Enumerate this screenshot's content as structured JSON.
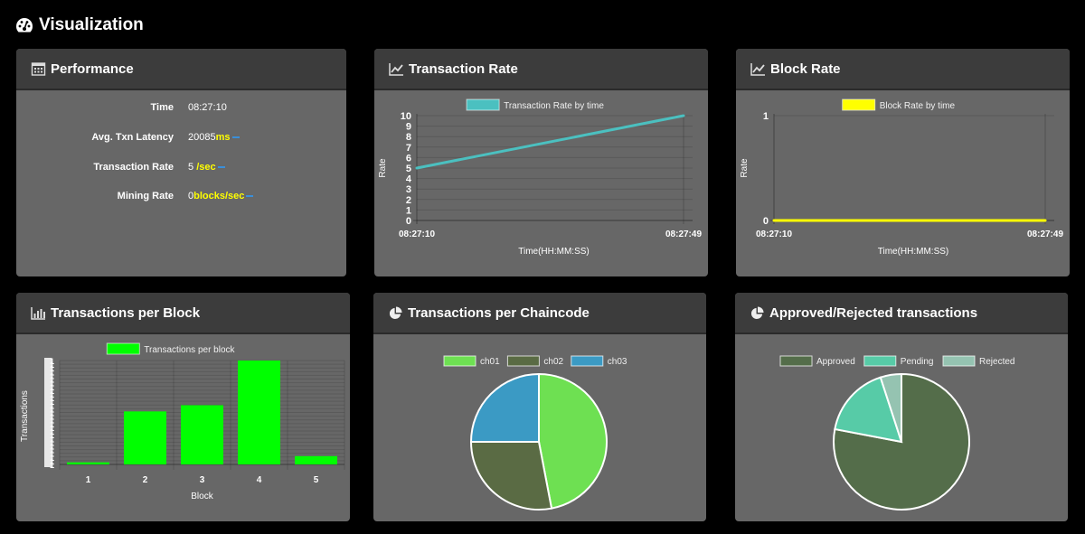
{
  "page": {
    "title": "Visualization",
    "icon": "dashboard-gauge-icon"
  },
  "performance": {
    "title": "Performance",
    "icon": "calendar-icon",
    "rows": [
      {
        "label": "Time",
        "value": "08:27:10",
        "unit": ""
      },
      {
        "label": "Avg. Txn Latency",
        "value": "20085",
        "unit": "ms"
      },
      {
        "label": "Transaction Rate",
        "value": "5 ",
        "unit": "/sec"
      },
      {
        "label": "Mining Rate",
        "value": "0",
        "unit": "blocks/sec"
      }
    ],
    "trend_indicator_color": "#3a8fd9",
    "unit_color": "#ffff00"
  },
  "transaction_rate": {
    "title": "Transaction Rate",
    "icon": "line-chart-icon"
  },
  "block_rate": {
    "title": "Block Rate",
    "icon": "line-chart-icon"
  },
  "transactions_per_block": {
    "title": "Transactions per Block",
    "icon": "bar-chart-icon"
  },
  "transactions_per_chaincode": {
    "title": "Transactions per Chaincode",
    "icon": "pie-chart-icon"
  },
  "approved_rejected": {
    "title": "Approved/Rejected transactions",
    "icon": "pie-chart-icon"
  },
  "chart_data": [
    {
      "id": "txrate",
      "type": "line",
      "legend": "Transaction Rate by time",
      "legend_position": "top",
      "x": [
        "08:27:10",
        "08:27:49"
      ],
      "x_seconds": [
        0,
        39
      ],
      "values": [
        5,
        10
      ],
      "xlabel": "Time(HH:MM:SS)",
      "ylabel": "Rate",
      "ylim": [
        0,
        10
      ],
      "yticks": [
        0,
        1,
        2,
        3,
        4,
        5,
        6,
        7,
        8,
        9,
        10
      ],
      "color": "#4bc0c0",
      "grid": true
    },
    {
      "id": "blkrate",
      "type": "line",
      "legend": "Block Rate by time",
      "legend_position": "top",
      "x": [
        "08:27:10",
        "08:27:49"
      ],
      "x_seconds": [
        0,
        39
      ],
      "values": [
        0,
        0
      ],
      "xlabel": "Time(HH:MM:SS)",
      "ylabel": "Rate",
      "ylim": [
        0,
        1
      ],
      "yticks": [
        0,
        1
      ],
      "color": "#ffff00",
      "grid": true
    },
    {
      "id": "txblock",
      "type": "bar",
      "legend": "Transactions per block",
      "legend_position": "top",
      "categories": [
        "1",
        "2",
        "3",
        "4",
        "5"
      ],
      "values": [
        2,
        51,
        57,
        100,
        8
      ],
      "xlabel": "Block",
      "ylabel": "Transactions",
      "ylim": [
        0,
        100
      ],
      "color": "#00ff00",
      "grid": true
    },
    {
      "id": "chaincode",
      "type": "pie",
      "legend_position": "top",
      "labels": [
        "ch01",
        "ch02",
        "ch03"
      ],
      "values": [
        47,
        28,
        25
      ],
      "colors": [
        "#6ee052",
        "#5a6b44",
        "#3b9ac4"
      ]
    },
    {
      "id": "approved",
      "type": "pie",
      "legend_position": "top",
      "labels": [
        "Approved",
        "Pending",
        "Rejected"
      ],
      "values": [
        78,
        17,
        5
      ],
      "colors": [
        "#546d4a",
        "#57cba7",
        "#95c3b1"
      ]
    }
  ]
}
